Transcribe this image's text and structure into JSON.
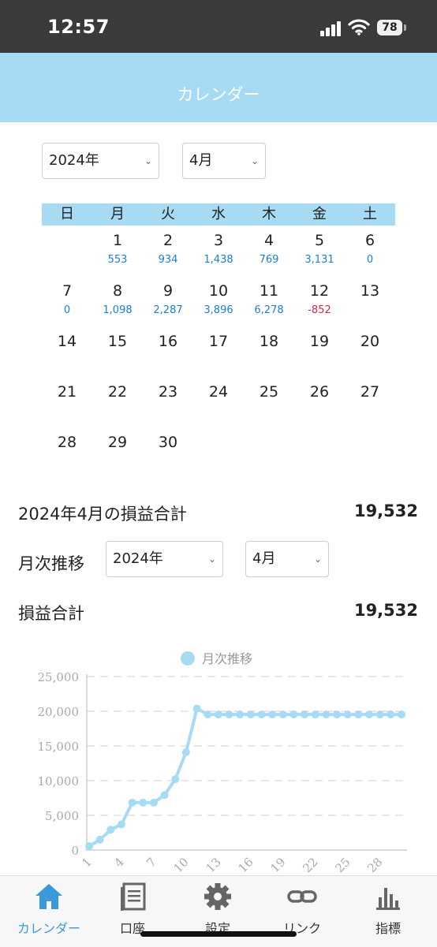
{
  "status_bar": {
    "time": "12:57",
    "battery": "78"
  },
  "header": {
    "title": "カレンダー"
  },
  "calendar_selectors": {
    "year": "2024年",
    "month": "4月"
  },
  "weekdays": [
    "日",
    "月",
    "火",
    "水",
    "木",
    "金",
    "土"
  ],
  "calendar_days": [
    {
      "day": "1",
      "value": "553"
    },
    {
      "day": "2",
      "value": "934"
    },
    {
      "day": "3",
      "value": "1,438"
    },
    {
      "day": "4",
      "value": "769"
    },
    {
      "day": "5",
      "value": "3,131"
    },
    {
      "day": "6",
      "value": "0"
    },
    {
      "day": "7",
      "value": "0"
    },
    {
      "day": "8",
      "value": "1,098"
    },
    {
      "day": "9",
      "value": "2,287"
    },
    {
      "day": "10",
      "value": "3,896"
    },
    {
      "day": "11",
      "value": "6,278"
    },
    {
      "day": "12",
      "value": "-852"
    },
    {
      "day": "13",
      "value": ""
    },
    {
      "day": "14",
      "value": ""
    },
    {
      "day": "15",
      "value": ""
    },
    {
      "day": "16",
      "value": ""
    },
    {
      "day": "17",
      "value": ""
    },
    {
      "day": "18",
      "value": ""
    },
    {
      "day": "19",
      "value": ""
    },
    {
      "day": "20",
      "value": ""
    },
    {
      "day": "21",
      "value": ""
    },
    {
      "day": "22",
      "value": ""
    },
    {
      "day": "23",
      "value": ""
    },
    {
      "day": "24",
      "value": ""
    },
    {
      "day": "25",
      "value": ""
    },
    {
      "day": "26",
      "value": ""
    },
    {
      "day": "27",
      "value": ""
    },
    {
      "day": "28",
      "value": ""
    },
    {
      "day": "29",
      "value": ""
    },
    {
      "day": "30",
      "value": ""
    }
  ],
  "first_weekday_index": 1,
  "summary": {
    "month_total_label": "2024年4月の損益合計",
    "month_total_value": "19,532"
  },
  "monthly": {
    "label": "月次推移",
    "year": "2024年",
    "month": "4月"
  },
  "pl_total": {
    "label": "損益合計",
    "value": "19,532"
  },
  "chart_data": {
    "type": "line",
    "legend": "月次推移",
    "x": [
      1,
      2,
      3,
      4,
      5,
      6,
      7,
      8,
      9,
      10,
      11,
      12,
      13,
      14,
      15,
      16,
      17,
      18,
      19,
      20,
      21,
      22,
      23,
      24,
      25,
      26,
      27,
      28,
      29,
      30
    ],
    "series": [
      {
        "name": "月次推移",
        "values": [
          553,
          1487,
          2925,
          3694,
          6825,
          6825,
          6825,
          7923,
          10210,
          14106,
          20384,
          19532,
          19532,
          19532,
          19532,
          19532,
          19532,
          19532,
          19532,
          19532,
          19532,
          19532,
          19532,
          19532,
          19532,
          19532,
          19532,
          19532,
          19532,
          19532
        ]
      }
    ],
    "x_tick_labels": [
      "1",
      "4",
      "7",
      "10",
      "13",
      "16",
      "19",
      "22",
      "25",
      "28"
    ],
    "y_ticks": [
      "0",
      "5,000",
      "10,000",
      "15,000",
      "20,000",
      "25,000"
    ],
    "ylim": [
      0,
      25000
    ],
    "grid": true,
    "legend_position": "top-center",
    "color": "#a6dbf3"
  },
  "tabs": [
    {
      "label": "カレンダー",
      "icon": "home-icon",
      "active": true
    },
    {
      "label": "口座",
      "icon": "document-icon",
      "active": false
    },
    {
      "label": "設定",
      "icon": "gear-icon",
      "active": false
    },
    {
      "label": "リンク",
      "icon": "link-icon",
      "active": false
    },
    {
      "label": "指標",
      "icon": "bar-chart-icon",
      "active": false
    }
  ],
  "colors": {
    "accent": "#a6dbf3",
    "positive": "#1a7fd6",
    "negative": "#d6264a",
    "active_tab": "#3a9ad9"
  }
}
